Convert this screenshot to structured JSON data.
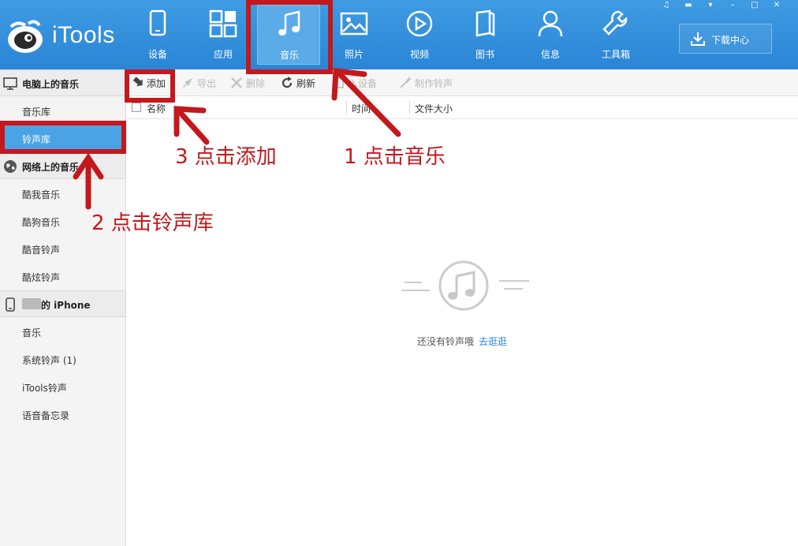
{
  "app": {
    "name": "iTools"
  },
  "nav": {
    "tabs": [
      {
        "id": "device",
        "label": "设备",
        "icon": "device-icon"
      },
      {
        "id": "apps",
        "label": "应用",
        "icon": "apps-grid-icon"
      },
      {
        "id": "music",
        "label": "音乐",
        "icon": "music-note-icon",
        "active": true
      },
      {
        "id": "photos",
        "label": "照片",
        "icon": "photo-icon"
      },
      {
        "id": "video",
        "label": "视频",
        "icon": "play-icon"
      },
      {
        "id": "books",
        "label": "图书",
        "icon": "book-icon"
      },
      {
        "id": "info",
        "label": "信息",
        "icon": "person-icon"
      },
      {
        "id": "toolbox",
        "label": "工具箱",
        "icon": "wrench-icon"
      }
    ],
    "download_center": "下载中心"
  },
  "sidebar": {
    "sections": [
      {
        "title": "电脑上的音乐",
        "icon": "monitor-icon",
        "items": [
          {
            "label": "音乐库"
          },
          {
            "label": "铃声库",
            "active": true
          }
        ]
      },
      {
        "title": "网络上的音乐",
        "icon": "globe-icon",
        "items": [
          {
            "label": "酷我音乐"
          },
          {
            "label": "酷狗音乐"
          },
          {
            "label": "酷音铃声"
          },
          {
            "label": "酷炫铃声"
          }
        ]
      },
      {
        "title": "的 iPhone",
        "icon": "phone-icon",
        "items": [
          {
            "label": "音乐"
          },
          {
            "label": "系统铃声 (1)"
          },
          {
            "label": "iTools铃声"
          },
          {
            "label": "语音备忘录"
          }
        ]
      }
    ]
  },
  "toolbar": {
    "add": "添加",
    "export": "导出",
    "delete": "删除",
    "refresh": "刷新",
    "import_device": "入设备",
    "make_ringtone": "制作铃声"
  },
  "columns": {
    "name": "名称",
    "time": "时间",
    "size": "文件大小"
  },
  "empty": {
    "message": "还没有铃声哦",
    "link": "去逛逛"
  },
  "annotations": {
    "step1": "1 点击音乐",
    "step2": "2 点击铃声库",
    "step3": "3 点击添加"
  },
  "colors": {
    "header": "#2a86d6",
    "active_tab": "#5aabe8",
    "annotation": "#c4181c",
    "link": "#2a86d6"
  }
}
